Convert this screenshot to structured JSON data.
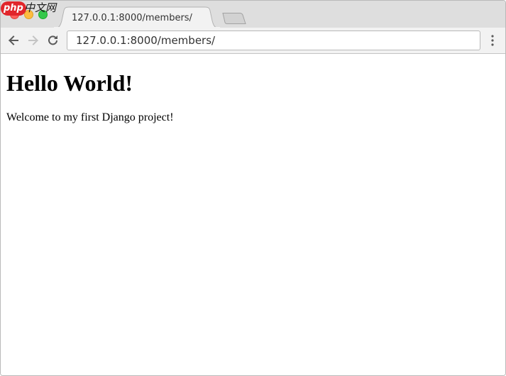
{
  "browser": {
    "tab": {
      "title": "127.0.0.1:8000/members/"
    },
    "address_bar": {
      "value": "127.0.0.1:8000/members/"
    },
    "icons": {
      "back": "arrow-left-icon",
      "forward": "arrow-right-icon",
      "reload": "reload-icon",
      "menu": "kebab-menu-icon"
    },
    "colors": {
      "close": "#fc605c",
      "minimize": "#fdbc40",
      "maximize": "#34c84a",
      "watermark": "#e1262b"
    }
  },
  "watermark": {
    "brand": "php",
    "site": "中文网"
  },
  "page": {
    "heading": "Hello World!",
    "paragraph": "Welcome to my first Django project!"
  }
}
